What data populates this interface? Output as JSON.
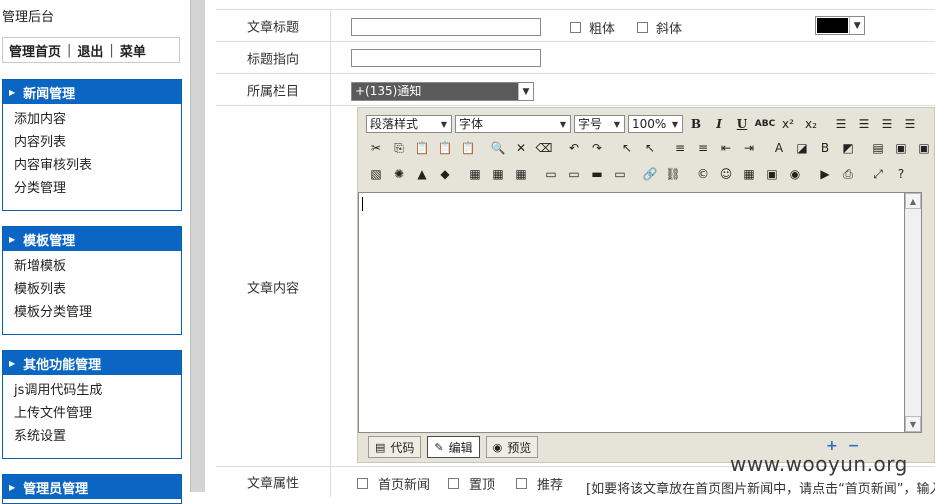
{
  "sidebar": {
    "title": "管理后台",
    "top_links": [
      "管理首页",
      "退出",
      "菜单"
    ],
    "sections": [
      {
        "title": "新闻管理",
        "items": [
          "添加内容",
          "内容列表",
          "内容审核列表",
          "分类管理"
        ]
      },
      {
        "title": "模板管理",
        "items": [
          "新增模板",
          "模板列表",
          "模板分类管理"
        ]
      },
      {
        "title": "其他功能管理",
        "items": [
          "js调用代码生成",
          "上传文件管理",
          "系统设置"
        ]
      },
      {
        "title": "管理员管理",
        "items": []
      }
    ]
  },
  "form": {
    "title_label": "文章标题",
    "title_value": "",
    "bold_label": "粗体",
    "italic_label": "斜体",
    "title_color": "#000000",
    "redirect_label": "标题指向",
    "redirect_value": "",
    "category_label": "所属栏目",
    "category_value": "+(135)通知",
    "content_label": "文章内容",
    "attr_label": "文章属性",
    "attr_options": [
      "首页新闻",
      "置顶",
      "推荐"
    ],
    "attr_hint": "[如要将该文章放在首页图片新闻中，请点击“首页新闻”，输入该"
  },
  "editor": {
    "paragraph_style": "段落样式",
    "font": "字体",
    "font_size": "字号",
    "zoom": "100%",
    "toolbar_text": {
      "bold": "B",
      "italic": "I",
      "underline": "U",
      "strike": "ABC",
      "superscript": "x²",
      "subscript": "x₂"
    },
    "modes": [
      "代码",
      "编辑",
      "预览"
    ],
    "active_mode": "编辑",
    "plus": "+",
    "minus": "−"
  },
  "watermark": "www.wooyun.org"
}
